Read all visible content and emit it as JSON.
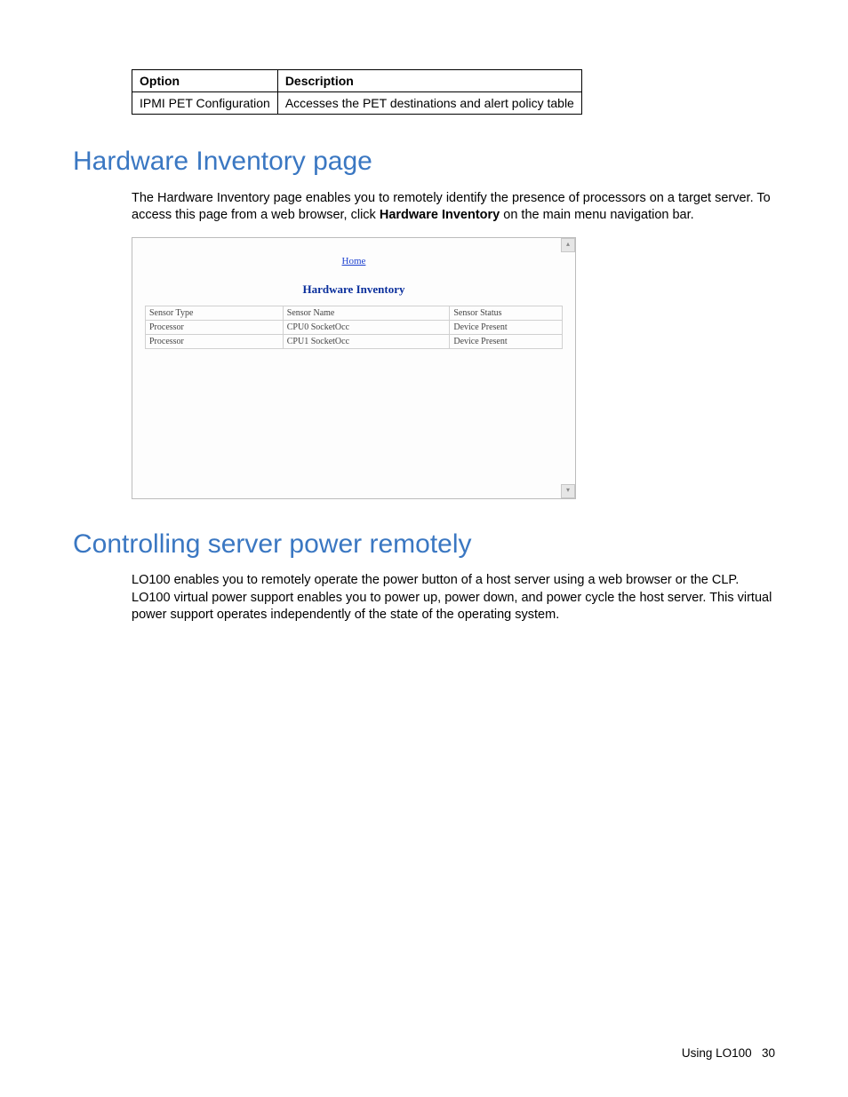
{
  "optionTable": {
    "headers": [
      "Option",
      "Description"
    ],
    "row": {
      "option": "IPMI PET Configuration",
      "description": "Accesses the PET destinations and alert policy table"
    }
  },
  "section1": {
    "heading": "Hardware Inventory page",
    "para_a": "The Hardware Inventory page enables you to remotely identify the presence of processors on a target server. To access this page from a web browser, click ",
    "para_b_bold": "Hardware Inventory",
    "para_c": " on the main menu navigation bar."
  },
  "screenshot": {
    "homeLink": "Home",
    "title": "Hardware Inventory",
    "headers": [
      "Sensor Type",
      "Sensor Name",
      "Sensor Status"
    ],
    "rows": [
      [
        "Processor",
        "CPU0 SocketOcc",
        "Device Present"
      ],
      [
        "Processor",
        "CPU1 SocketOcc",
        "Device Present"
      ]
    ]
  },
  "section2": {
    "heading": "Controlling server power remotely",
    "para": "LO100 enables you to remotely operate the power button of a host server using a web browser or the CLP. LO100 virtual power support enables you to power up, power down, and power cycle the host server. This virtual power support operates independently of the state of the operating system."
  },
  "footer": {
    "text": "Using LO100",
    "page": "30"
  }
}
